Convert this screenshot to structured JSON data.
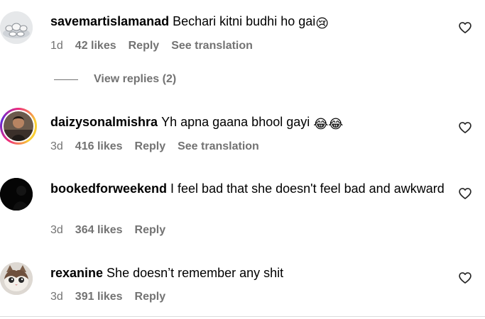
{
  "comments": [
    {
      "username": "savemartislamanad",
      "text": "Bechari kitni budhi ho gai",
      "emoji": "😢",
      "time": "1d",
      "likes": "42 likes",
      "reply": "Reply",
      "translation": "See translation",
      "avatar_icon": "teacup-avatar"
    },
    {
      "username": "daizysonalmishra",
      "text": "Yh apna gaana bhool gayi",
      "emoji": "😂😂",
      "time": "3d",
      "likes": "416 likes",
      "reply": "Reply",
      "translation": "See translation",
      "avatar_icon": "story-ring-avatar"
    },
    {
      "username": "bookedforweekend",
      "text": "I feel bad that she doesn't feel bad and awkward",
      "time": "3d",
      "likes": "364 likes",
      "reply": "Reply",
      "avatar_icon": "dark-avatar"
    },
    {
      "username": "rexanine",
      "text": "She doesn’t remember any shit",
      "time": "3d",
      "likes": "391 likes",
      "reply": "Reply",
      "avatar_icon": "cat-avatar"
    }
  ],
  "view_replies": "View replies (2)",
  "colors": {
    "meta": "#737373",
    "story_ring_start": "#f9ce34",
    "story_ring_end": "#ee2a7b"
  }
}
